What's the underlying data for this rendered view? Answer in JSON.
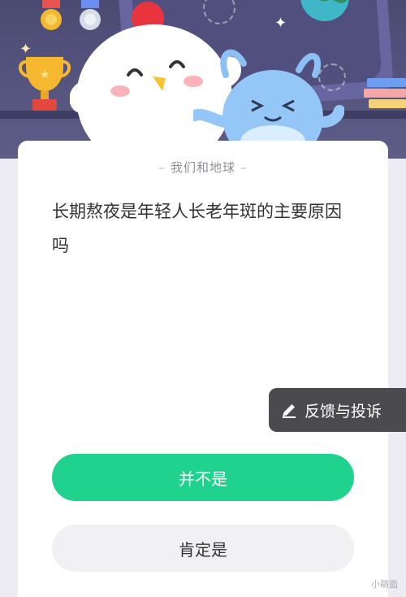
{
  "card": {
    "subtitle": "我们和地球",
    "question": "长期熬夜是年轻人长老年斑的主要原因吗"
  },
  "answers": [
    {
      "label": "并不是"
    },
    {
      "label": "肯定是"
    }
  ],
  "feedback": {
    "label": "反馈与投诉",
    "icon": "pencil-icon"
  },
  "watermark": {
    "label": "小萌面"
  },
  "colors": {
    "primary_answer_bg": "#1fd38f",
    "secondary_answer_bg": "#f1f1f3",
    "feedback_bg": "#4b4b4f",
    "banner_bg": "#4f4e78"
  }
}
